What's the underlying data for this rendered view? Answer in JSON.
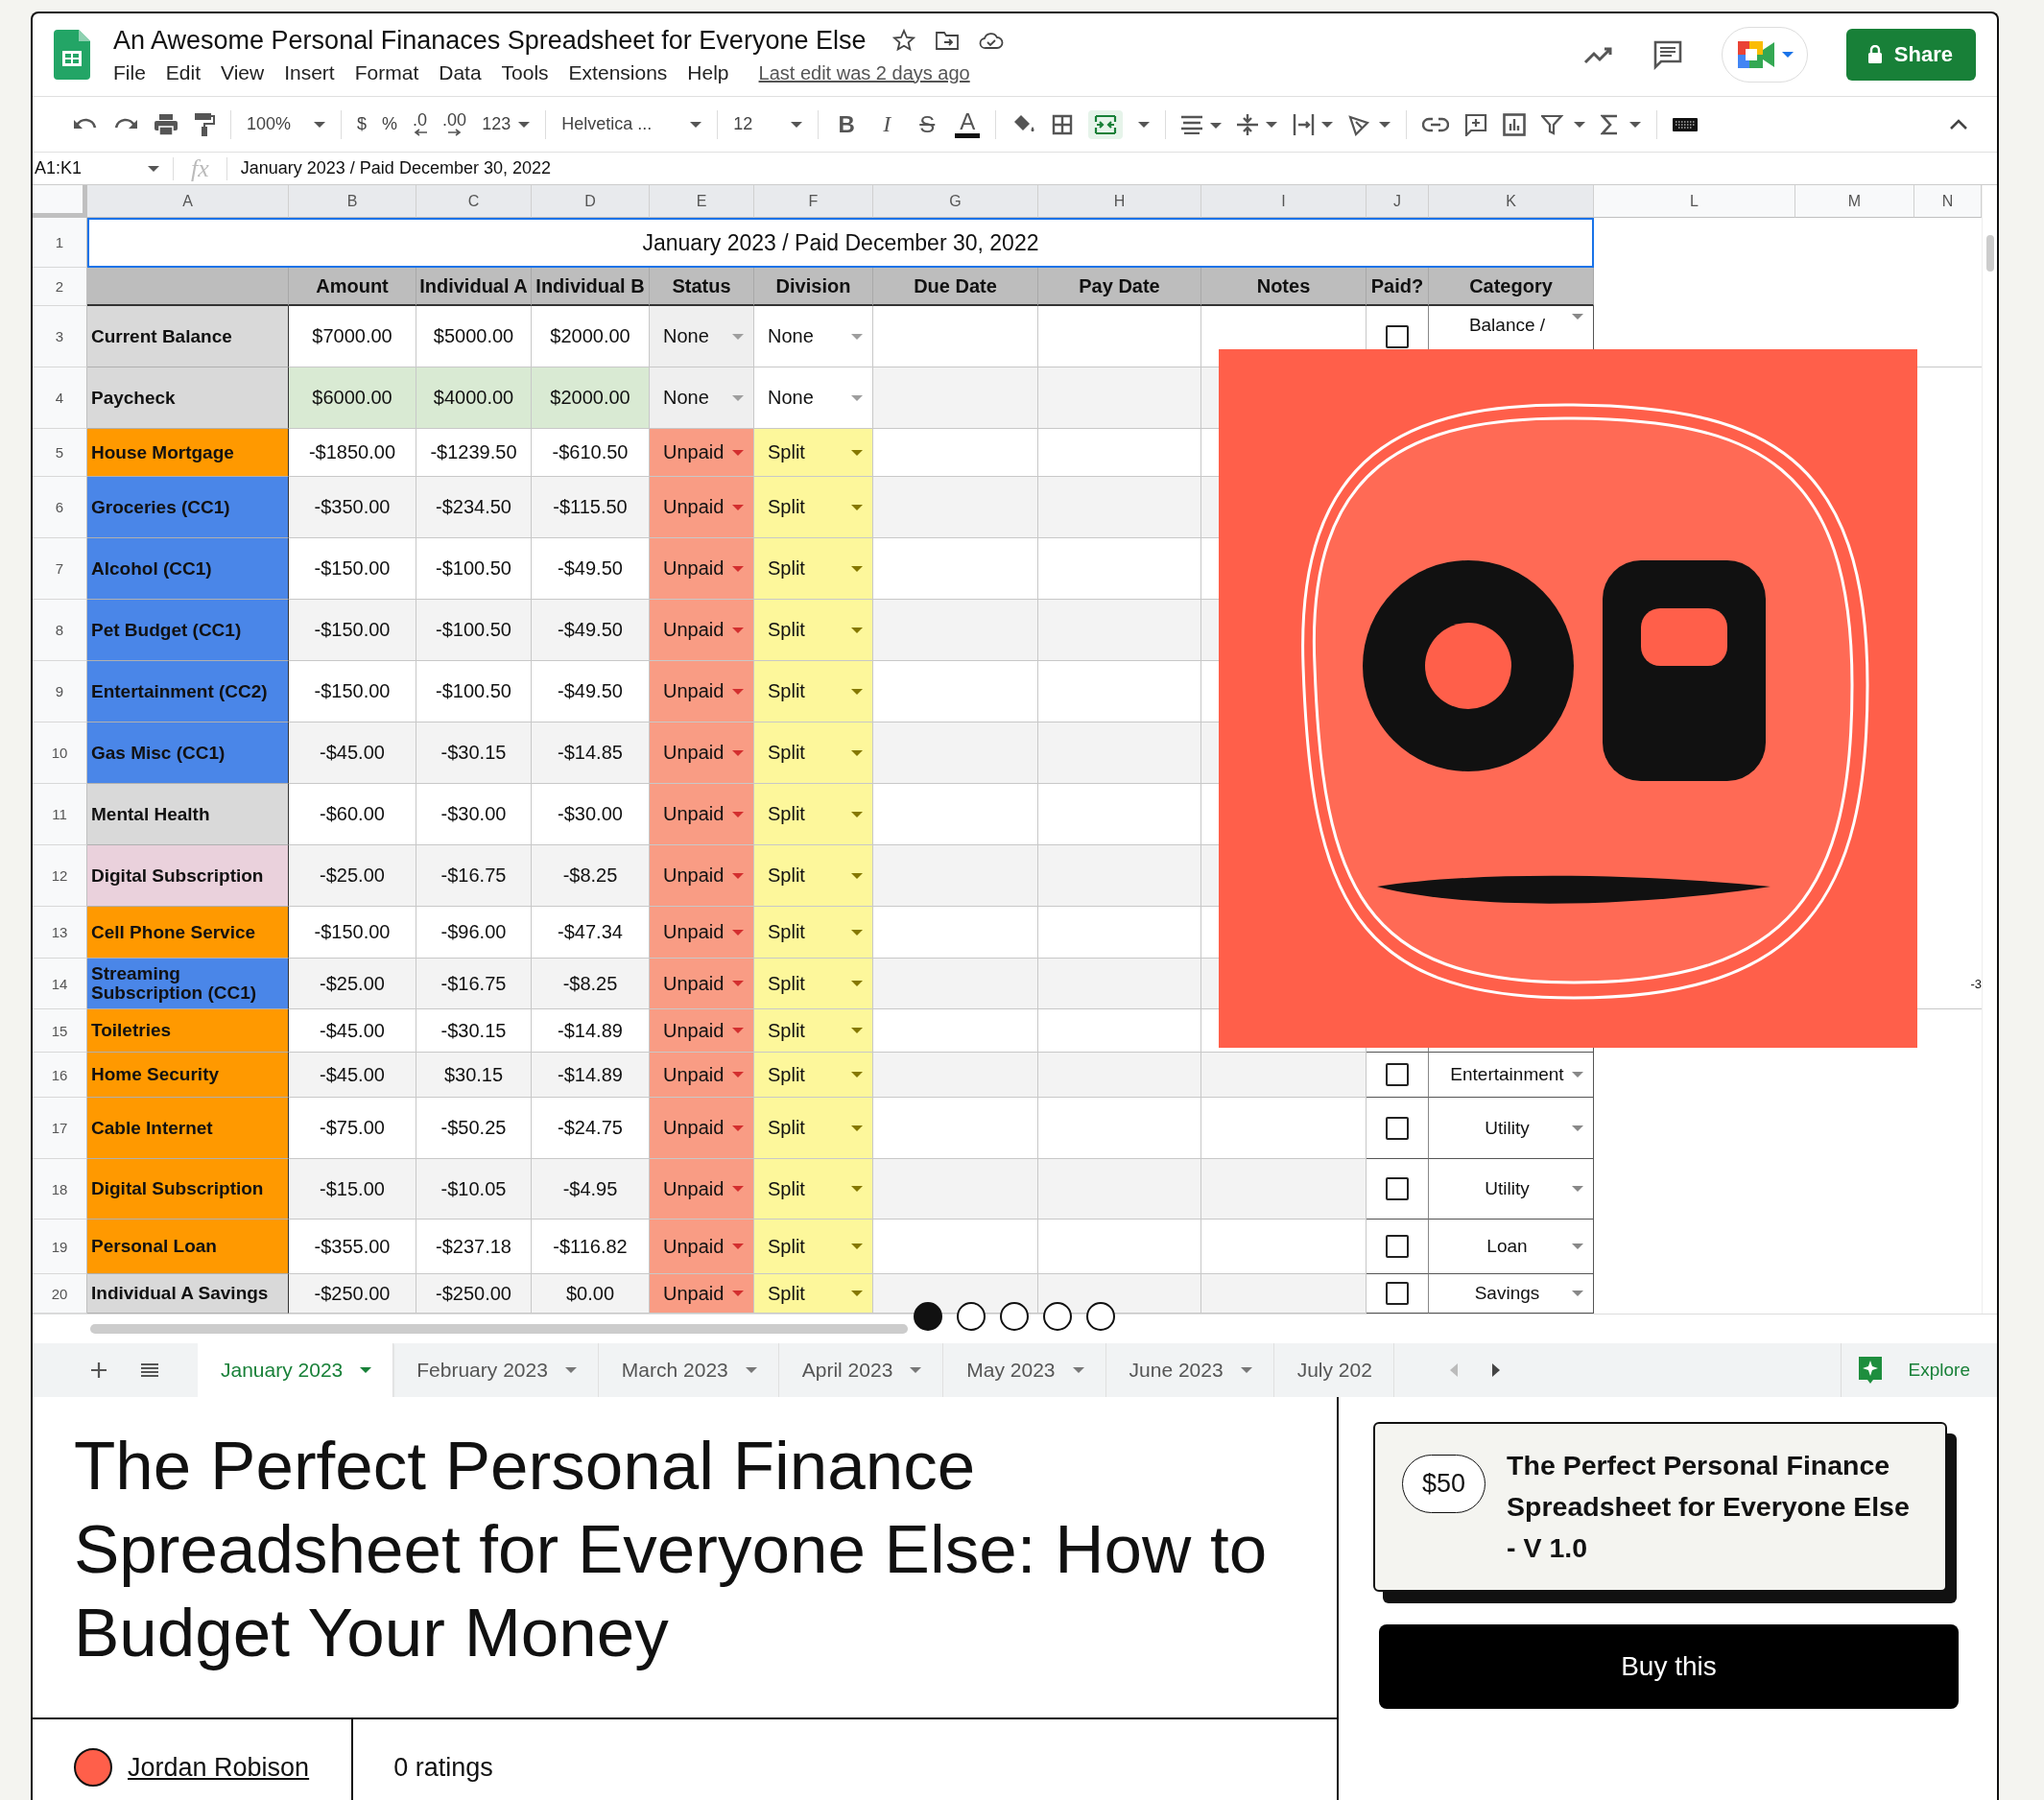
{
  "sheet": {
    "title": "An Awesome Personal Finanaces Spreadsheet for Everyone Else",
    "menu": [
      "File",
      "Edit",
      "View",
      "Insert",
      "Format",
      "Data",
      "Tools",
      "Extensions",
      "Help"
    ],
    "last_edit": "Last edit was 2 days ago",
    "share_button": "Share",
    "toolbar": {
      "zoom": "100%",
      "currency": "$",
      "percent": "%",
      "decrease_decimal": ".0",
      "increase_decimal": ".00",
      "number_format": "123",
      "font": "Helvetica ...",
      "font_size": "12",
      "bold": "B",
      "italic": "I",
      "strikethrough": "S",
      "text_color": "A",
      "merge_selected": true
    },
    "name_box": "A1:K1",
    "fx_label": "fx",
    "formula": "January 2023 / Paid December 30, 2022",
    "columns": [
      "A",
      "B",
      "C",
      "D",
      "E",
      "F",
      "G",
      "H",
      "I",
      "J",
      "K",
      "L",
      "M",
      "N"
    ],
    "title_row": {
      "number": "1",
      "text": "January 2023 / Paid December 30, 2022"
    },
    "header_row": {
      "number": "2",
      "cells": [
        "Amount",
        "Individual A",
        "Individual B",
        "Status",
        "Division",
        "Due Date",
        "Pay Date",
        "Notes",
        "Paid?",
        "Category"
      ]
    },
    "rows": [
      {
        "number": "3",
        "label": "Current Balance",
        "color": "#d9d9d9",
        "kind": "balance",
        "amount": "$7000.00",
        "individual_a": "$5000.00",
        "individual_b": "$2000.00",
        "status": "None",
        "division": "None",
        "paid": false,
        "category": "Balance /"
      },
      {
        "number": "4",
        "label": "Paycheck",
        "color": "#d9d9d9",
        "kind": "income",
        "amount": "$6000.00",
        "individual_a": "$4000.00",
        "individual_b": "$2000.00",
        "status": "None",
        "division": "None"
      },
      {
        "number": "5",
        "label": "House Mortgage",
        "color": "#ff9900",
        "kind": "expense",
        "amount": "-$1850.00",
        "individual_a": "-$1239.50",
        "individual_b": "-$610.50",
        "status": "Unpaid",
        "division": "Split"
      },
      {
        "number": "6",
        "label": "Groceries (CC1)",
        "color": "#4a86e8",
        "kind": "expense",
        "amount": "-$350.00",
        "individual_a": "-$234.50",
        "individual_b": "-$115.50",
        "status": "Unpaid",
        "division": "Split"
      },
      {
        "number": "7",
        "label": "Alcohol (CC1)",
        "color": "#4a86e8",
        "kind": "expense",
        "amount": "-$150.00",
        "individual_a": "-$100.50",
        "individual_b": "-$49.50",
        "status": "Unpaid",
        "division": "Split"
      },
      {
        "number": "8",
        "label": "Pet Budget (CC1)",
        "color": "#4a86e8",
        "kind": "expense",
        "amount": "-$150.00",
        "individual_a": "-$100.50",
        "individual_b": "-$49.50",
        "status": "Unpaid",
        "division": "Split"
      },
      {
        "number": "9",
        "label": "Entertainment (CC2)",
        "color": "#4a86e8",
        "kind": "expense",
        "amount": "-$150.00",
        "individual_a": "-$100.50",
        "individual_b": "-$49.50",
        "status": "Unpaid",
        "division": "Split"
      },
      {
        "number": "10",
        "label": "Gas Misc (CC1)",
        "color": "#4a86e8",
        "kind": "expense",
        "amount": "-$45.00",
        "individual_a": "-$30.15",
        "individual_b": "-$14.85",
        "status": "Unpaid",
        "division": "Split"
      },
      {
        "number": "11",
        "label": "Mental Health",
        "color": "#d9d9d9",
        "kind": "expense",
        "amount": "-$60.00",
        "individual_a": "-$30.00",
        "individual_b": "-$30.00",
        "status": "Unpaid",
        "division": "Split"
      },
      {
        "number": "12",
        "label": "Digital Subscription",
        "color": "#ead1dc",
        "kind": "expense",
        "amount": "-$25.00",
        "individual_a": "-$16.75",
        "individual_b": "-$8.25",
        "status": "Unpaid",
        "division": "Split"
      },
      {
        "number": "13",
        "label": "Cell Phone Service",
        "color": "#ff9900",
        "kind": "expense",
        "amount": "-$150.00",
        "individual_a": "-$96.00",
        "individual_b": "-$47.34",
        "status": "Unpaid",
        "division": "Split"
      },
      {
        "number": "14",
        "label": "Streaming Subscription (CC1)",
        "color": "#4a86e8",
        "kind": "expense",
        "amount": "-$25.00",
        "individual_a": "-$16.75",
        "individual_b": "-$8.25",
        "status": "Unpaid",
        "division": "Split",
        "column_n": "-3"
      },
      {
        "number": "15",
        "label": "Toiletries",
        "color": "#ff9900",
        "kind": "expense",
        "amount": "-$45.00",
        "individual_a": "-$30.15",
        "individual_b": "-$14.89",
        "status": "Unpaid",
        "division": "Split"
      },
      {
        "number": "16",
        "label": "Home Security",
        "color": "#ff9900",
        "kind": "expense",
        "amount": "-$45.00",
        "individual_a": "$30.15",
        "individual_b": "-$14.89",
        "status": "Unpaid",
        "division": "Split",
        "paid": false,
        "category": "Entertainment"
      },
      {
        "number": "17",
        "label": "Cable Internet",
        "color": "#ff9900",
        "kind": "expense",
        "amount": "-$75.00",
        "individual_a": "-$50.25",
        "individual_b": "-$24.75",
        "status": "Unpaid",
        "division": "Split",
        "paid": false,
        "category": "Utility"
      },
      {
        "number": "18",
        "label": "Digital Subscription",
        "color": "#ff9900",
        "kind": "expense",
        "amount": "-$15.00",
        "individual_a": "-$10.05",
        "individual_b": "-$4.95",
        "status": "Unpaid",
        "division": "Split",
        "paid": false,
        "category": "Utility"
      },
      {
        "number": "19",
        "label": "Personal Loan",
        "color": "#ff9900",
        "kind": "expense",
        "amount": "-$355.00",
        "individual_a": "-$237.18",
        "individual_b": "-$116.82",
        "status": "Unpaid",
        "division": "Split",
        "paid": false,
        "category": "Loan"
      },
      {
        "number": "20",
        "label": "Individual A Savings",
        "color": "#d9d9d9",
        "kind": "expense",
        "amount": "-$250.00",
        "individual_a": "-$250.00",
        "individual_b": "$0.00",
        "status": "Unpaid",
        "division": "Split",
        "paid": false,
        "category": "Savings"
      }
    ],
    "sheet_tabs": [
      {
        "label": "January 2023",
        "selected": true
      },
      {
        "label": "February 2023",
        "selected": false
      },
      {
        "label": "March 2023",
        "selected": false
      },
      {
        "label": "April 2023",
        "selected": false
      },
      {
        "label": "May 2023",
        "selected": false
      },
      {
        "label": "June 2023",
        "selected": false
      },
      {
        "label": "July 202",
        "selected": false
      }
    ],
    "explore_button": "Explore"
  },
  "carousel_dots": [
    {
      "selected": true
    },
    {
      "selected": false
    },
    {
      "selected": false
    },
    {
      "selected": false
    },
    {
      "selected": false
    }
  ],
  "product": {
    "title": "The Perfect Personal Finance Spreadsheet for Everyone Else: How to Budget Your Money",
    "author": "Jordan Robison",
    "ratings": "0 ratings",
    "price": "$50",
    "card_title": "The Perfect Personal Finance Spreadsheet for Everyone Else - V 1.0",
    "buy_button": "Buy this"
  }
}
